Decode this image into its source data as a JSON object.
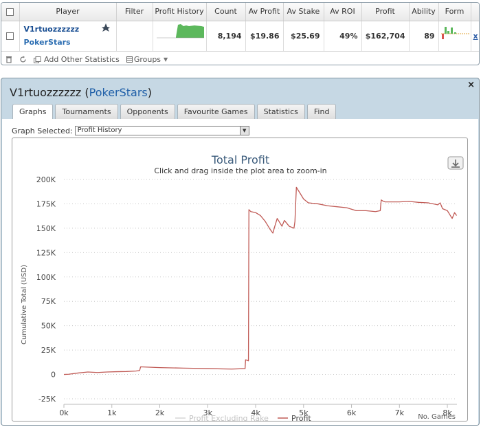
{
  "table": {
    "headers": [
      "Player",
      "Filter",
      "Profit History",
      "Count",
      "Av Profit",
      "Av Stake",
      "Av ROI",
      "Profit",
      "Ability",
      "Form"
    ],
    "row": {
      "player_name": "V1rtuozzzzzz",
      "site": "PokerStars",
      "count": "8,194",
      "av_profit": "$19.86",
      "av_stake": "$25.69",
      "av_roi": "49%",
      "profit": "$162,704",
      "ability": "89",
      "remove": "x"
    }
  },
  "toolbar": {
    "add_stats": "Add Other Statistics",
    "groups": "Groups"
  },
  "window": {
    "player_name": "V1rtuozzzzzz",
    "open_paren": " (",
    "site": "PokerStars",
    "close_paren": ")",
    "close": "×"
  },
  "tabs": [
    "Graphs",
    "Tournaments",
    "Opponents",
    "Favourite Games",
    "Statistics",
    "Find"
  ],
  "graph_select": {
    "label": "Graph Selected:",
    "value": "Profit History"
  },
  "colors": {
    "profit_line": "#c05a55",
    "excl_rake_line": "#d6d6d6",
    "title": "#3b5b7b",
    "window_bg": "#c6d8e4",
    "spark_fill": "#5cb85c"
  },
  "chart_data": {
    "type": "line",
    "title": "Total Profit",
    "subtitle": "Click and drag inside the plot area to zoom-in",
    "xlabel": "No. Games",
    "ylabel": "Cumulative Total (USD)",
    "xlim": [
      0,
      8200
    ],
    "ylim": [
      -25000,
      200000
    ],
    "x_ticks": [
      "0k",
      "1k",
      "2k",
      "3k",
      "4k",
      "5k",
      "6k",
      "7k",
      "8k"
    ],
    "y_ticks": [
      "-25K",
      "0",
      "25K",
      "50K",
      "75K",
      "100K",
      "125K",
      "150K",
      "175K",
      "200K"
    ],
    "grid": true,
    "legend_position": "bottom",
    "series": [
      {
        "name": "Profit Excluding Rake",
        "values": []
      },
      {
        "name": "Profit",
        "x": [
          0,
          100,
          300,
          500,
          700,
          900,
          1100,
          1300,
          1500,
          1580,
          1600,
          2000,
          2500,
          3000,
          3500,
          3780,
          3790,
          3850,
          3860,
          3900,
          4000,
          4100,
          4200,
          4300,
          4360,
          4400,
          4450,
          4500,
          4550,
          4600,
          4700,
          4800,
          4820,
          4850,
          4900,
          5000,
          5100,
          5300,
          5500,
          5700,
          5900,
          6100,
          6300,
          6500,
          6600,
          6620,
          6650,
          6700,
          6800,
          7000,
          7200,
          7400,
          7600,
          7800,
          7850,
          7900,
          8000,
          8050,
          8100,
          8150,
          8194
        ],
        "values": [
          0,
          200,
          1500,
          2500,
          2000,
          2500,
          2800,
          3000,
          3500,
          4000,
          7800,
          7000,
          6500,
          6000,
          5500,
          6000,
          15000,
          14000,
          169000,
          167000,
          166000,
          163000,
          157000,
          149000,
          145000,
          152000,
          160000,
          156000,
          152000,
          158000,
          152000,
          150000,
          157000,
          192000,
          188000,
          180000,
          176000,
          175000,
          173000,
          172000,
          171000,
          168000,
          168000,
          167000,
          168000,
          179000,
          178000,
          177000,
          177000,
          177000,
          177500,
          176500,
          176000,
          174000,
          176000,
          170000,
          168000,
          164000,
          160000,
          166000,
          163000
        ]
      }
    ]
  }
}
